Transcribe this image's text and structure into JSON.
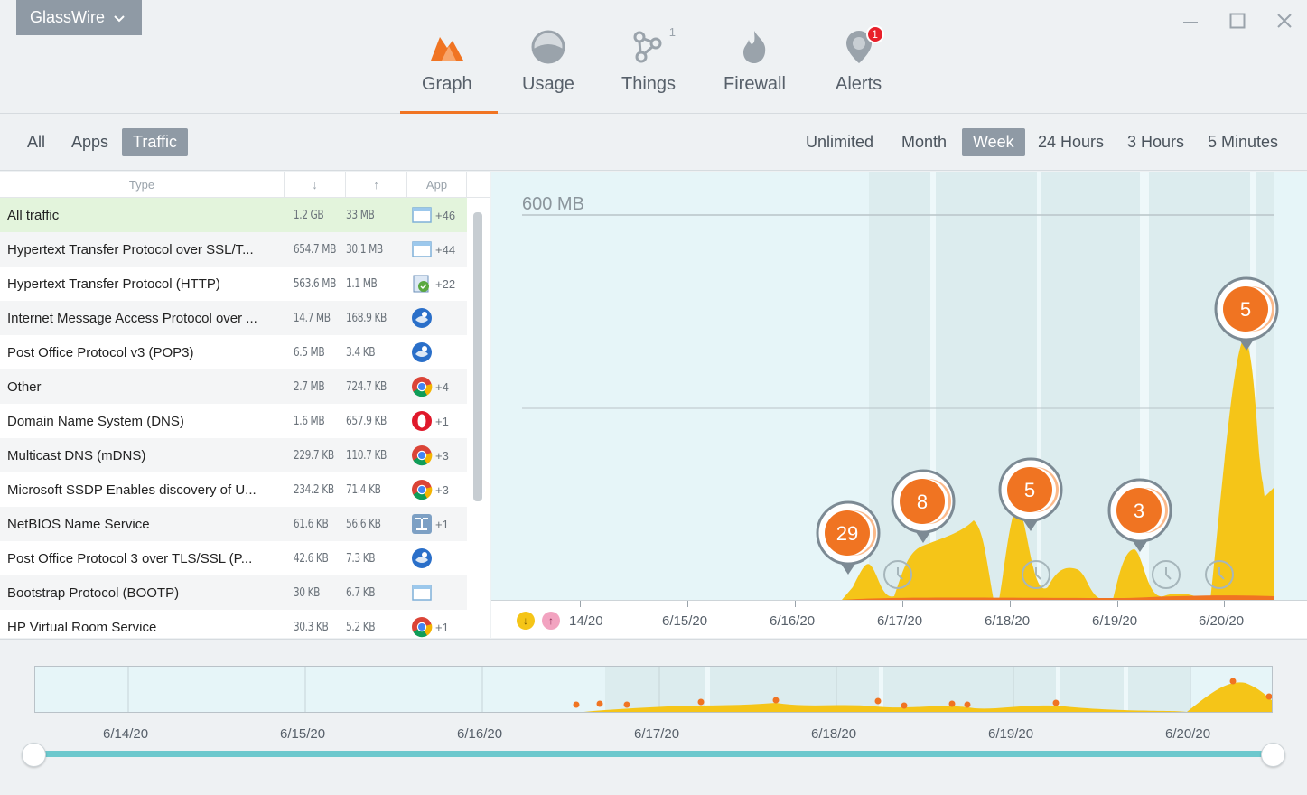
{
  "app_menu": {
    "label": "GlassWire"
  },
  "nav": {
    "items": [
      {
        "label": "Graph",
        "icon": "graph-icon"
      },
      {
        "label": "Usage",
        "icon": "usage-icon"
      },
      {
        "label": "Things",
        "icon": "things-icon",
        "count": "1"
      },
      {
        "label": "Firewall",
        "icon": "firewall-icon"
      },
      {
        "label": "Alerts",
        "icon": "alerts-icon",
        "badge": "1"
      }
    ],
    "active": "Graph"
  },
  "filters": {
    "view": [
      {
        "label": "All"
      },
      {
        "label": "Apps"
      },
      {
        "label": "Traffic",
        "active": true
      }
    ],
    "range": [
      {
        "label": "Unlimited"
      },
      {
        "label": "Month"
      },
      {
        "label": "Week",
        "active": true
      },
      {
        "label": "24 Hours"
      },
      {
        "label": "3 Hours"
      },
      {
        "label": "5 Minutes"
      }
    ]
  },
  "table": {
    "headers": {
      "type": "Type",
      "down": "↓",
      "up": "↑",
      "app": "App"
    },
    "rows": [
      {
        "type": "All traffic",
        "down": "1.2 GB",
        "up": "33 MB",
        "app_icon": "window-icon",
        "app_extra": "+46",
        "selected": true
      },
      {
        "type": "Hypertext Transfer Protocol over SSL/T...",
        "down": "654.7 MB",
        "up": "30.1 MB",
        "app_icon": "window-icon",
        "app_extra": "+44"
      },
      {
        "type": "Hypertext Transfer Protocol (HTTP)",
        "down": "563.6 MB",
        "up": "1.1 MB",
        "app_icon": "updater-icon",
        "app_extra": "+22"
      },
      {
        "type": "Internet Message Access Protocol over ...",
        "down": "14.7 MB",
        "up": "168.9 KB",
        "app_icon": "thunderbird-icon",
        "app_extra": ""
      },
      {
        "type": "Post Office Protocol v3 (POP3)",
        "down": "6.5 MB",
        "up": "3.4 KB",
        "app_icon": "thunderbird-icon",
        "app_extra": ""
      },
      {
        "type": "Other",
        "down": "2.7 MB",
        "up": "724.7 KB",
        "app_icon": "chrome-icon",
        "app_extra": "+4"
      },
      {
        "type": "Domain Name System (DNS)",
        "down": "1.6 MB",
        "up": "657.9 KB",
        "app_icon": "opera-icon",
        "app_extra": "+1"
      },
      {
        "type": "Multicast DNS (mDNS)",
        "down": "229.7 KB",
        "up": "110.7 KB",
        "app_icon": "chrome-icon",
        "app_extra": "+3"
      },
      {
        "type": "Microsoft SSDP Enables discovery of U...",
        "down": "234.2 KB",
        "up": "71.4 KB",
        "app_icon": "chrome-icon",
        "app_extra": "+3"
      },
      {
        "type": "NetBIOS Name Service",
        "down": "61.6 KB",
        "up": "56.6 KB",
        "app_icon": "network-icon",
        "app_extra": "+1"
      },
      {
        "type": "Post Office Protocol 3 over TLS/SSL (P...",
        "down": "42.6 KB",
        "up": "7.3 KB",
        "app_icon": "thunderbird-icon",
        "app_extra": ""
      },
      {
        "type": "Bootstrap Protocol (BOOTP)",
        "down": "30 KB",
        "up": "6.7 KB",
        "app_icon": "window-icon",
        "app_extra": ""
      },
      {
        "type": "HP Virtual Room Service",
        "down": "30.3 KB",
        "up": "5.2 KB",
        "app_icon": "chrome-icon",
        "app_extra": "+1"
      }
    ]
  },
  "graph": {
    "scale_label": "600 MB",
    "axis_labels": [
      "14/20",
      "6/15/20",
      "6/16/20",
      "6/17/20",
      "6/18/20",
      "6/19/20",
      "6/20/20"
    ],
    "markers": [
      "29",
      "8",
      "5",
      "3",
      "5"
    ],
    "colors": {
      "download": "#f5c518",
      "upload": "#f07422",
      "accent": "#f07422",
      "marker_ring": "#7c8a94"
    }
  },
  "overview": {
    "axis_labels": [
      "6/14/20",
      "6/15/20",
      "6/16/20",
      "6/17/20",
      "6/18/20",
      "6/19/20",
      "6/20/20"
    ]
  }
}
